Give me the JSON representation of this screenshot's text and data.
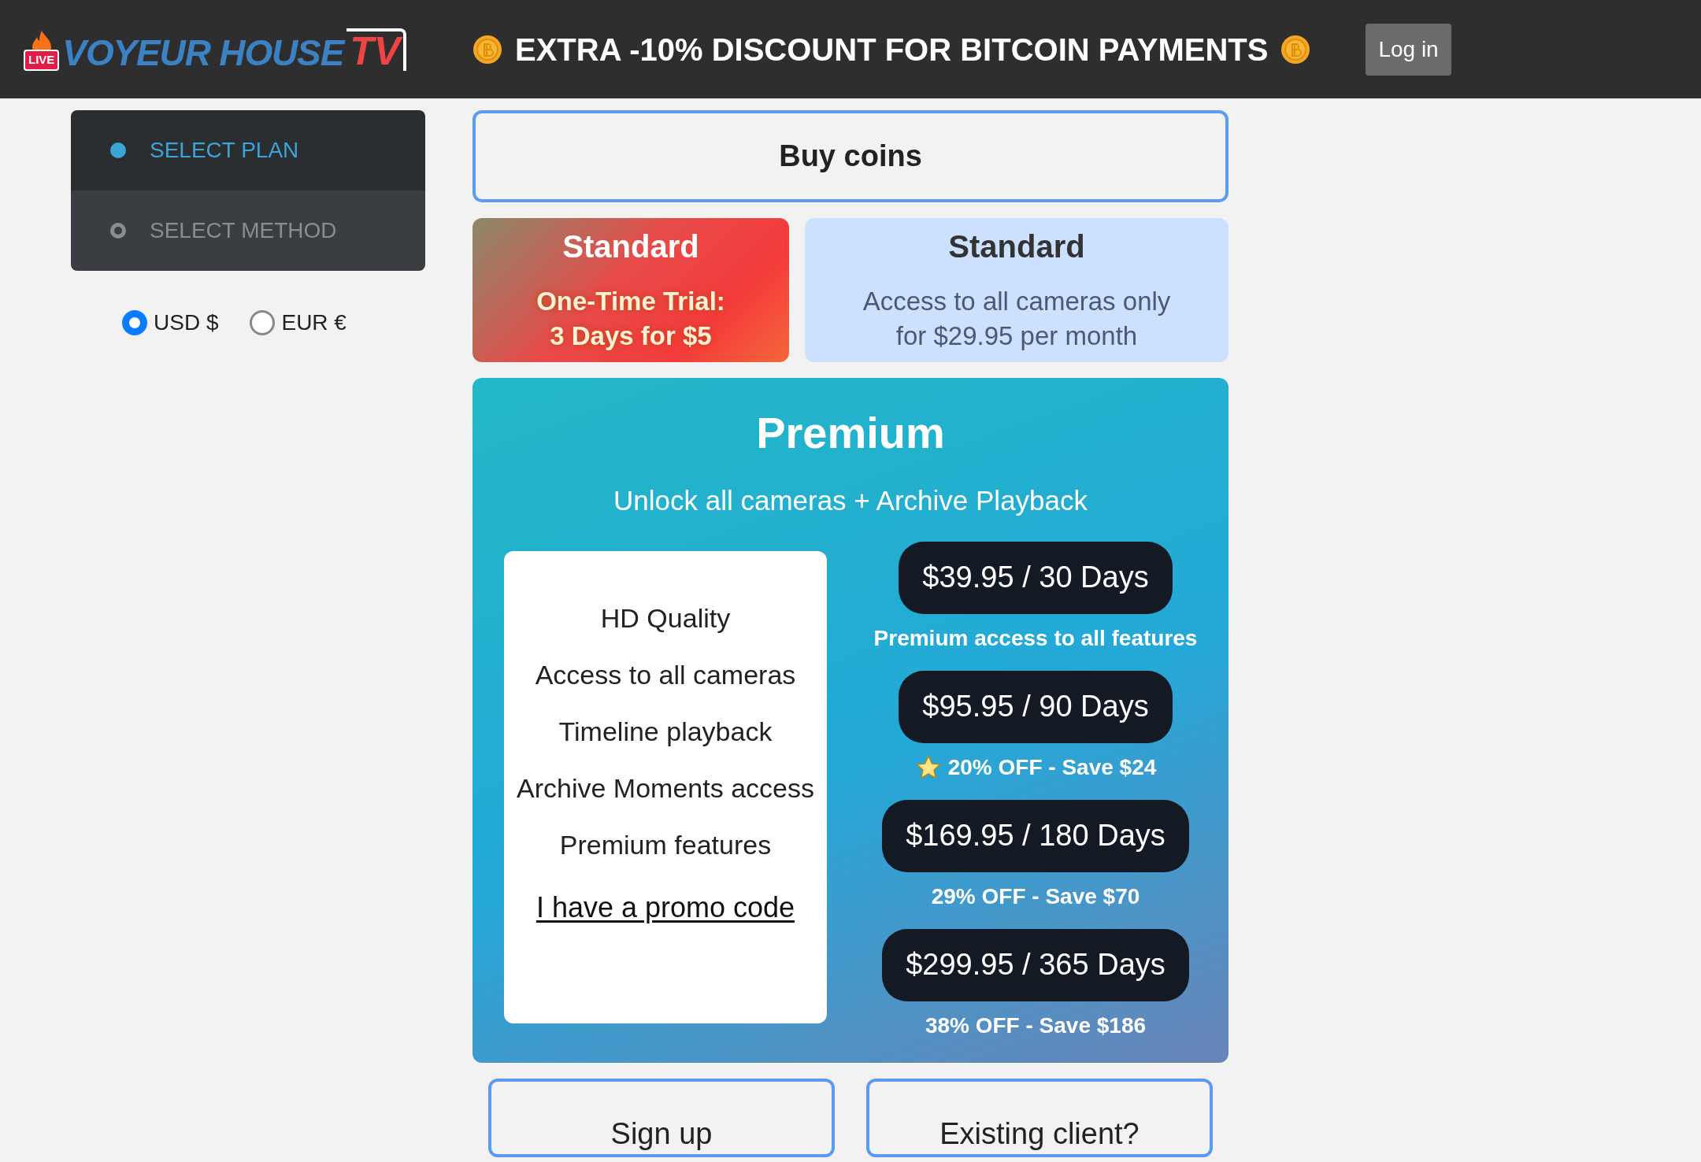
{
  "header": {
    "logo": {
      "badge": "LIVE",
      "name": "VOYEUR HOUSE",
      "suffix": "TV"
    },
    "promo": "EXTRA -10% DISCOUNT FOR BITCOIN PAYMENTS",
    "login": "Log in"
  },
  "steps": [
    {
      "label": "SELECT PLAN",
      "selected": true
    },
    {
      "label": "SELECT METHOD",
      "selected": false
    }
  ],
  "currencies": [
    {
      "label": "USD $",
      "selected": true
    },
    {
      "label": "EUR €",
      "selected": false
    }
  ],
  "buy_coins": "Buy coins",
  "standard_cards": [
    {
      "kind": "trial",
      "title": "Standard",
      "lines": [
        "One-Time Trial:",
        "3 Days for $5"
      ]
    },
    {
      "kind": "plain",
      "title": "Standard",
      "lines": [
        "Access to all cameras only",
        "for $29.95 per month"
      ]
    }
  ],
  "premium": {
    "title": "Premium",
    "subtitle": "Unlock all cameras + Archive Playback",
    "features": [
      "HD Quality",
      "Access to all cameras",
      "Timeline playback",
      "Archive Moments access",
      "Premium features"
    ],
    "promo_link": "I have a promo code",
    "plans": [
      {
        "price": "$39.95 / 30 Days",
        "note": "Premium access to all features",
        "starred": false
      },
      {
        "price": "$95.95 / 90 Days",
        "note": "20% OFF - Save $24",
        "starred": true
      },
      {
        "price": "$169.95 / 180 Days",
        "note": "29% OFF - Save $70",
        "starred": false
      },
      {
        "price": "$299.95 / 365 Days",
        "note": "38% OFF - Save $186",
        "starred": false
      }
    ]
  },
  "bottom_buttons": [
    "Sign up",
    "Existing client?"
  ]
}
